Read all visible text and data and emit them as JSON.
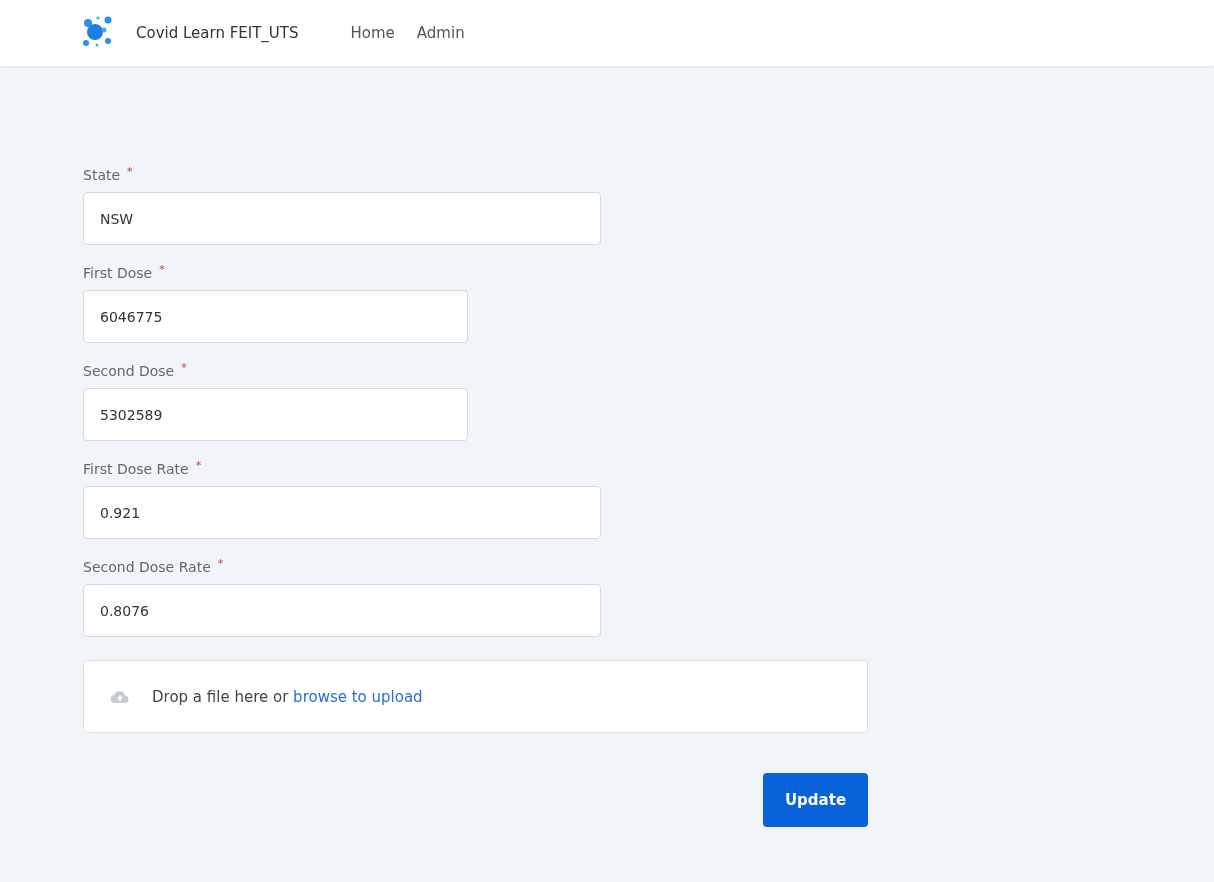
{
  "header": {
    "brand": "Covid Learn FEIT_UTS",
    "nav": [
      {
        "label": "Home"
      },
      {
        "label": "Admin"
      }
    ]
  },
  "form": {
    "fields": [
      {
        "label": "State",
        "required_mark": "*",
        "value": "NSW"
      },
      {
        "label": "First Dose",
        "required_mark": "*",
        "value": "6046775"
      },
      {
        "label": "Second Dose",
        "required_mark": "*",
        "value": "5302589"
      },
      {
        "label": "First Dose Rate",
        "required_mark": "*",
        "value": "0.921"
      },
      {
        "label": "Second Dose Rate",
        "required_mark": "*",
        "value": "0.8076"
      }
    ],
    "upload": {
      "text": "Drop a file here or ",
      "link": "browse to upload"
    },
    "submit": "Update"
  }
}
